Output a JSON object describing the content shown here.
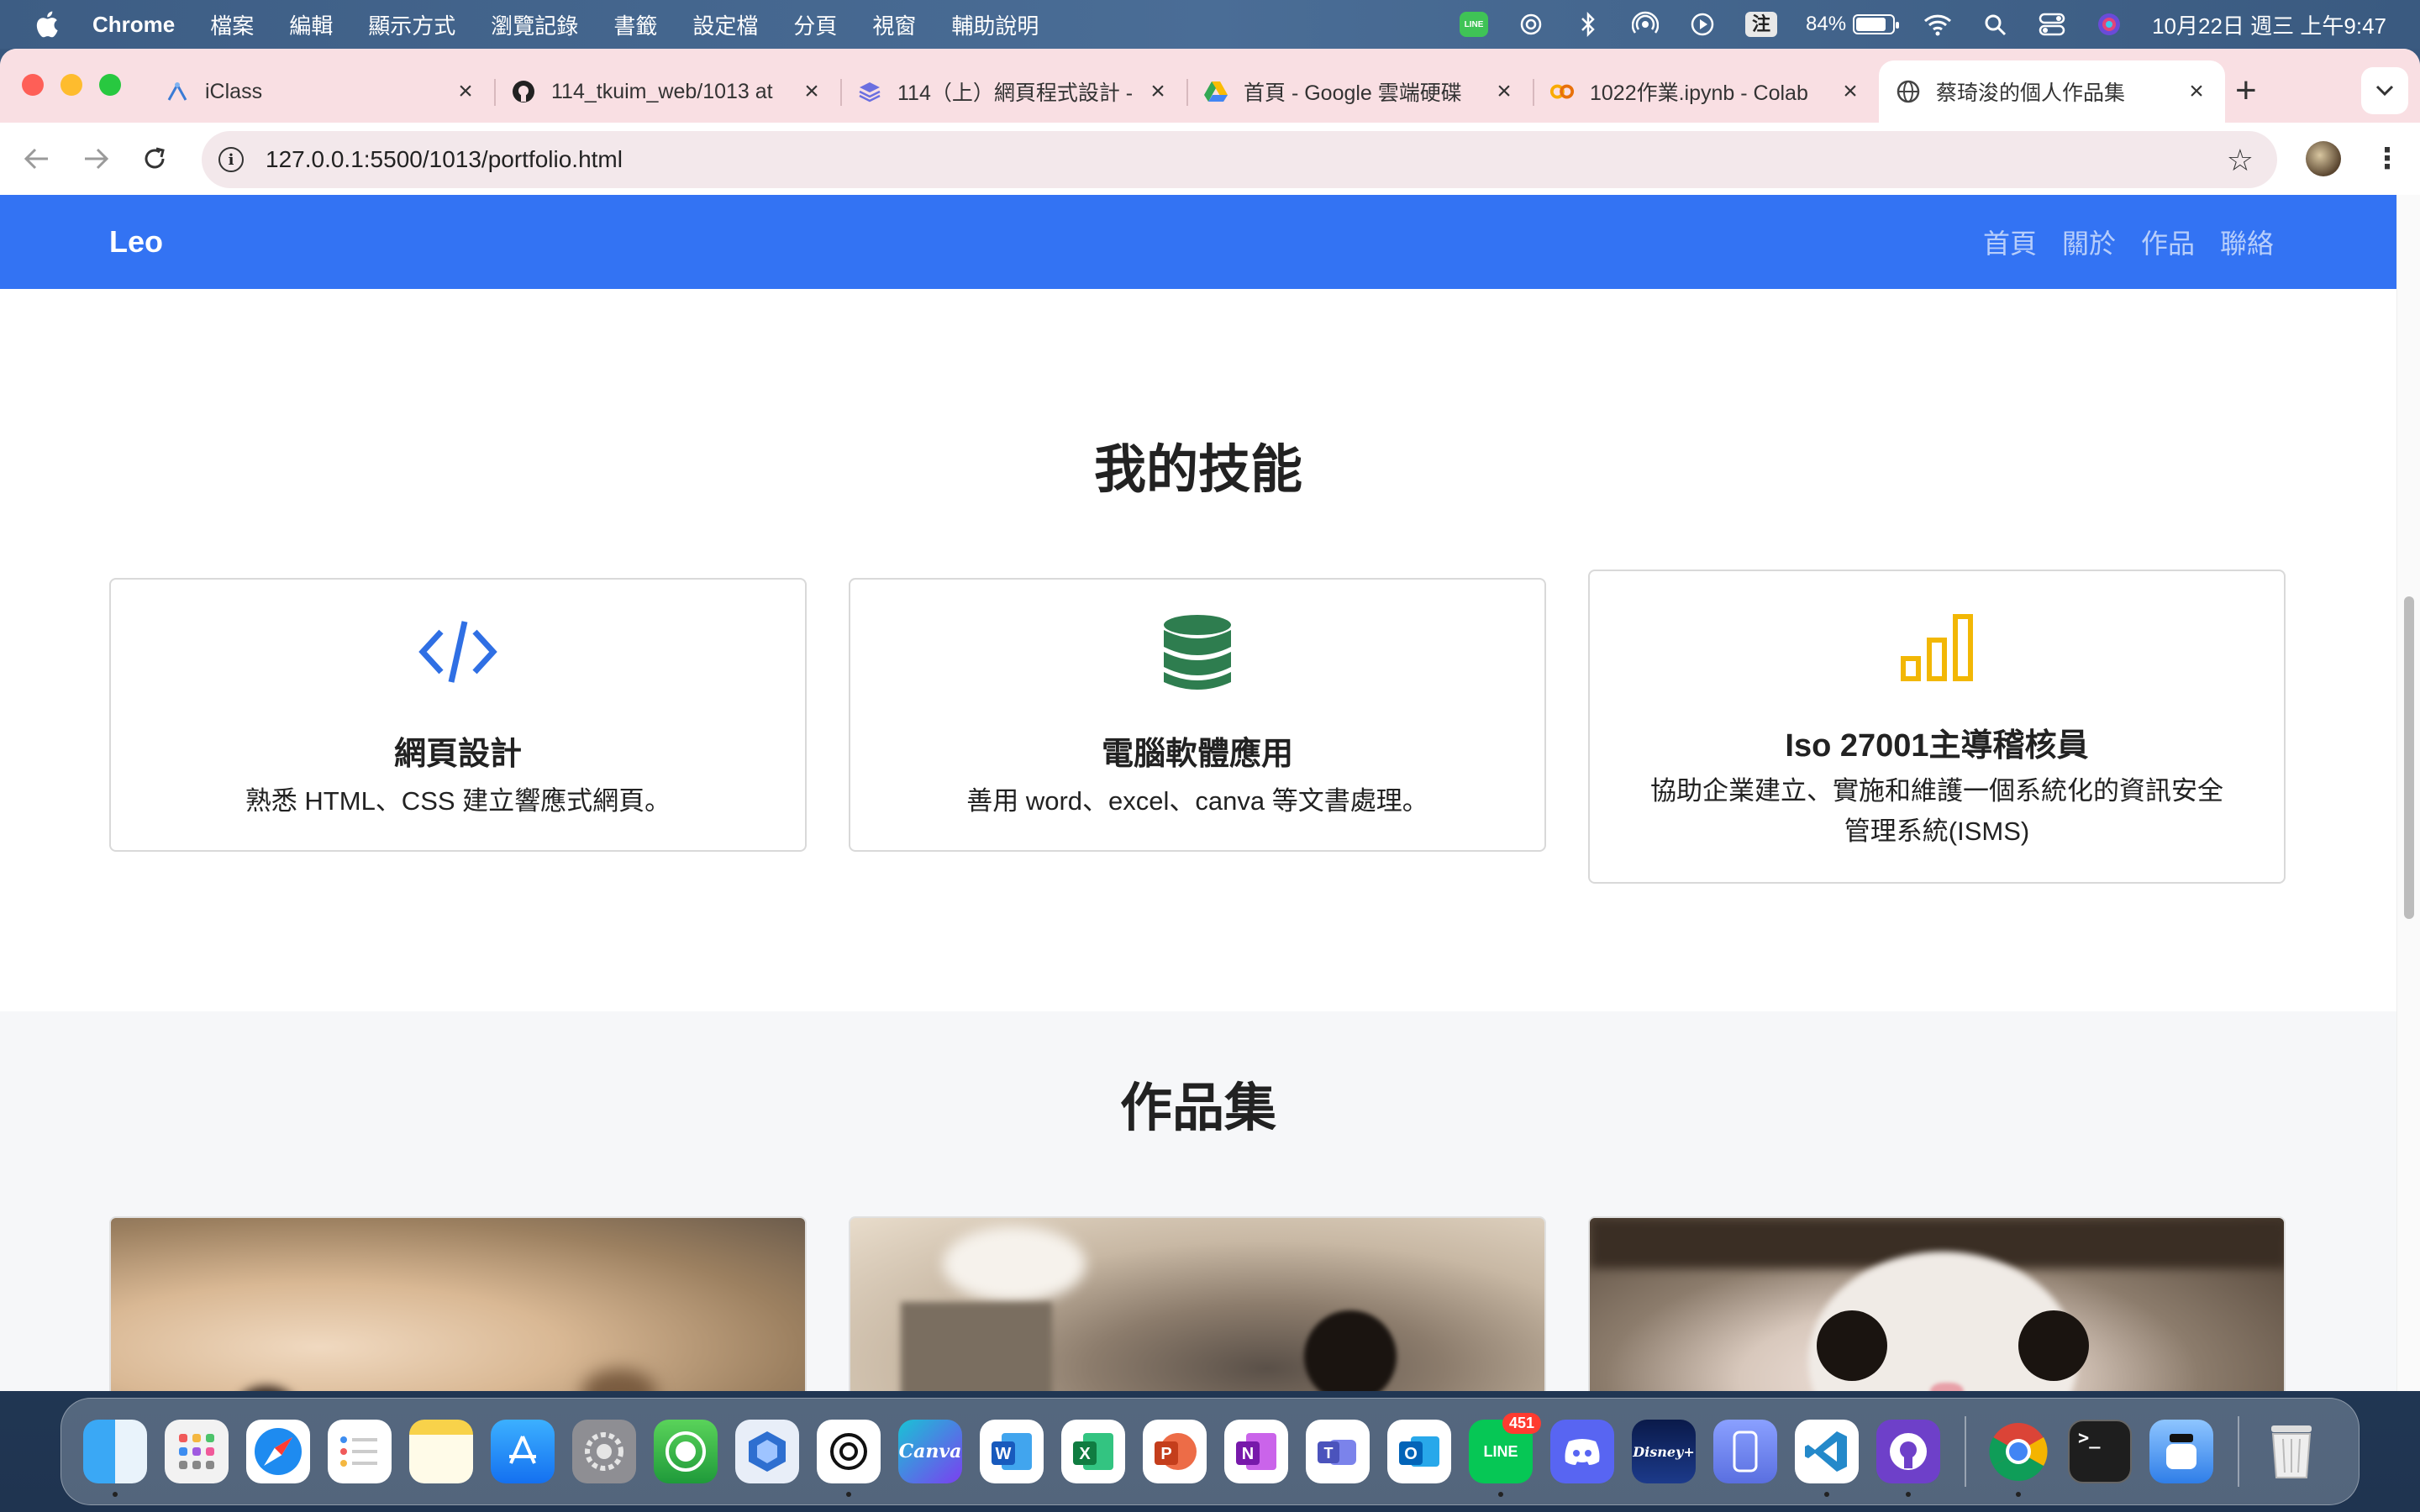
{
  "menubar": {
    "app_name": "Chrome",
    "menus": [
      "檔案",
      "編輯",
      "顯示方式",
      "瀏覽記錄",
      "書籤",
      "設定檔",
      "分頁",
      "視窗",
      "輔助說明"
    ],
    "ime_label": "注",
    "battery_percent": "84%",
    "battery_level": 0.84,
    "clock": "10月22日 週三 上午9:47"
  },
  "browser": {
    "tabs": [
      {
        "title": "iClass",
        "icon": "iclass-icon"
      },
      {
        "title": "114_tkuim_web/1013 at",
        "icon": "github-icon"
      },
      {
        "title": "114（上）網頁程式設計 -",
        "icon": "stack-icon"
      },
      {
        "title": "首頁 - Google 雲端硬碟",
        "icon": "google-drive-icon"
      },
      {
        "title": "1022作業.ipynb - Colab",
        "icon": "colab-icon"
      },
      {
        "title": "蔡琦浚的個人作品集",
        "icon": "globe-icon",
        "active": true
      }
    ],
    "url": "127.0.0.1:5500/1013/portfolio.html"
  },
  "site": {
    "brand": "Leo",
    "nav": [
      "首頁",
      "關於",
      "作品",
      "聯絡"
    ],
    "skills_heading": "我的技能",
    "skills": [
      {
        "title": "網頁設計",
        "text": "熟悉 HTML、CSS 建立響應式網頁。",
        "icon": "code-icon",
        "color": "#2f6fe4"
      },
      {
        "title": "電腦軟體應用",
        "text": "善用 word、excel、canva 等文書處理。",
        "icon": "database-icon",
        "color": "#2e7d4f"
      },
      {
        "title": "Iso 27001主導稽核員",
        "text": "協助企業建立、實施和維護一個系統化的資訊安全管理系統(ISMS)",
        "icon": "bar-chart-icon",
        "color": "#f2b705"
      }
    ],
    "portfolio_heading": "作品集"
  },
  "dock": {
    "line_badge": "451"
  },
  "colors": {
    "nav_bg": "#3373f3",
    "tab_bar_bg": "#f9dfe3"
  }
}
